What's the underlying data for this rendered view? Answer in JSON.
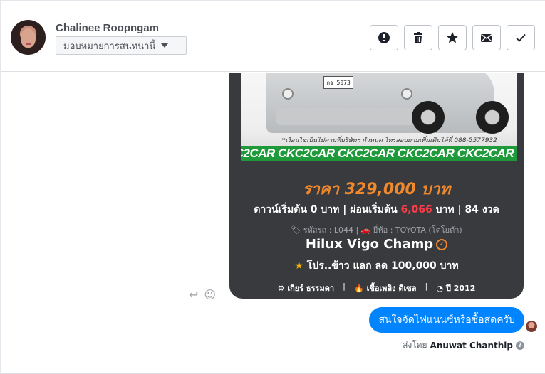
{
  "header": {
    "name": "Chalinee Roopngam",
    "assign_label": "มอบหมายการสนทนานี้",
    "actions": [
      "spam-icon",
      "trash-icon",
      "star-icon",
      "envelope-icon",
      "check-icon"
    ]
  },
  "card": {
    "plate": "กจ 5073",
    "disclaimer": "*เงื่อนไขเป็นไปตามที่บริษัทฯ กำหนด โทรสอบถามเพิ่มเติมได้ที่ 088-5577932",
    "ribbon": "KC2CAR CKC2CAR CKC2CAR CKC2CAR CKC2CAR CKC2",
    "price": "ราคา 329,000 บาท",
    "down_prefix": "ดาวน์เริ่มต้น 0 บาท | ผ่อนเริ่มต้น ",
    "installment": "6,066",
    "down_suffix": " บาท | 84 งวด",
    "meta": "🏷 รหัสรถ : L044 | 🚗 ยี่ห้อ : TOYOTA (โตโยต้า)",
    "model": "Hilux Vigo Champ",
    "promo": "โปร..ข้าว แลก ลด 100,000 บาท",
    "gear": "⚙ เกียร์ ธรรมดา",
    "fuel": "🔥 เชื้อเพลิง ดีเซล",
    "year": "◔ ปี 2012"
  },
  "message": {
    "text": "สนใจจัดไฟแนนซ์หรือซื้อสดครับ",
    "sent_by_label": "ส่งโดย",
    "sender": "Anuwat Chanthip"
  },
  "colors": {
    "accent": "#0084ff",
    "price": "#f0892c",
    "installment": "#ff3b49",
    "card_bg": "#383a3d"
  }
}
